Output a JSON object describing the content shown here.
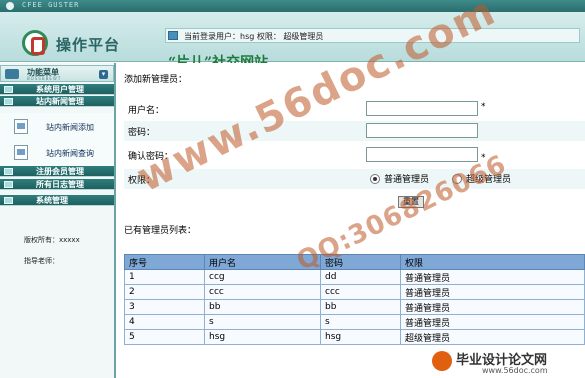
{
  "topbar": {
    "brand": "CFEE GUSTER"
  },
  "header": {
    "logo_text": "操作平台",
    "login_info": "当前登录用户：hsg 权限： 超级管理员",
    "site_title": "“片儿”社交网站"
  },
  "sidebar": {
    "menu_title": "功能菜单",
    "menu_subtitle": "BOSSBBEWT",
    "categories": {
      "system_users": "系统用户管理",
      "site_news": "站内新闻管理",
      "registered_members": "注册会员管理",
      "all_logs": "所有日志管理",
      "system": "系统管理"
    },
    "subitems": {
      "add_news": "站内新闻添加",
      "query_news": "站内新闻查询"
    },
    "copyright": "版权所有：xxxxx",
    "teacher": "指导老师："
  },
  "main": {
    "section_title": "添加新管理员：",
    "form": {
      "username_label": "用户名：",
      "password_label": "密码：",
      "confirm_label": "确认密码：",
      "permission_label": "权限：",
      "required_mark": "*",
      "options": [
        "普通管理员",
        "超级管理员"
      ],
      "selected_option": "普通管理员",
      "submit_label": "重置"
    },
    "list_title": "已有管理员列表：",
    "table": {
      "headers": [
        "序号",
        "用户名",
        "密码",
        "权限"
      ],
      "rows": [
        [
          "1",
          "ccg",
          "dd",
          "普通管理员"
        ],
        [
          "2",
          "ccc",
          "ccc",
          "普通管理员"
        ],
        [
          "3",
          "bb",
          "bb",
          "普通管理员"
        ],
        [
          "4",
          "s",
          "s",
          "普通管理员"
        ],
        [
          "5",
          "hsg",
          "hsg",
          "超级管理员"
        ]
      ]
    }
  },
  "watermark": {
    "url": "www.56doc.com",
    "qq": "QQ:306826066",
    "logo_title": "毕业设计论文网",
    "logo_url": "www.56doc.com"
  }
}
